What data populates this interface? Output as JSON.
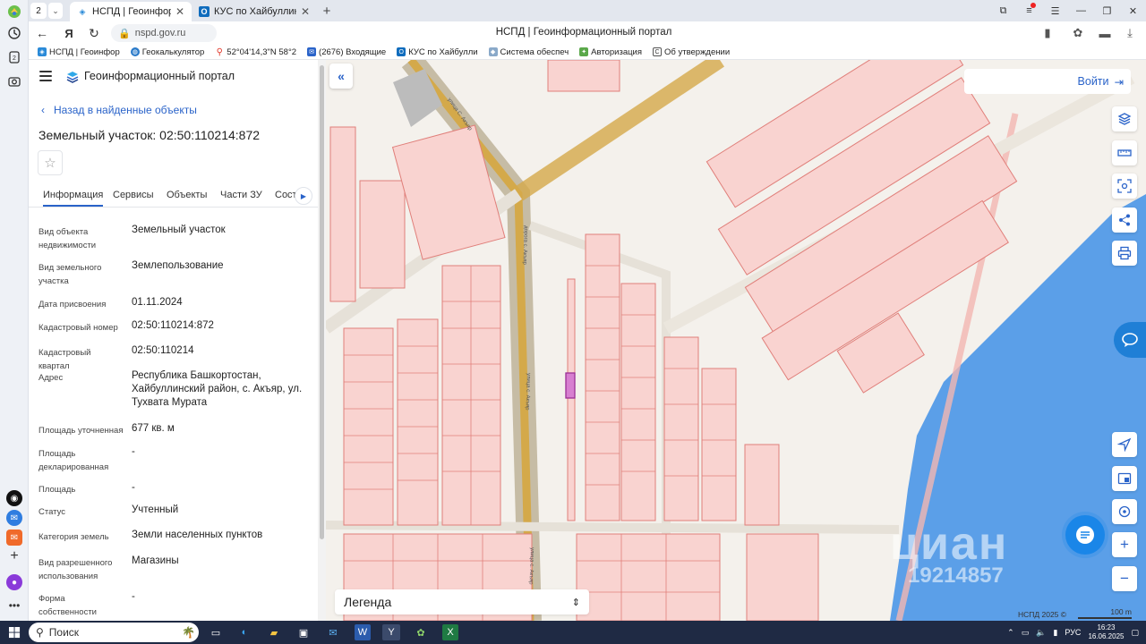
{
  "browser": {
    "tab_count": "2",
    "tabs": [
      {
        "title": "НСПД | Геоинформационный портал",
        "active": true
      },
      {
        "title": "КУС по Хайбуллинскому району",
        "active": false
      }
    ],
    "url": "nspd.gov.ru",
    "page_title": "НСПД | Геоинформационный портал",
    "bookmarks": [
      "НСПД | Геоинфор",
      "Геокалькулятор",
      "52°04'14,3\"N 58°2",
      "(2676) Входящие",
      "КУС по Хайбулли",
      "Система обеспеч",
      "Авторизация",
      "Об утверждении"
    ]
  },
  "sidebar": {
    "portal_name": "Геоинформационный портал",
    "back_link": "Назад в найденные объекты",
    "title": "Земельный участок: 02:50:110214:872",
    "tabs": [
      "Информация",
      "Сервисы",
      "Объекты",
      "Части ЗУ",
      "Соста"
    ],
    "rows": [
      {
        "label": "Вид объекта недвижимости",
        "value": "Земельный участок"
      },
      {
        "label": "Вид земельного участка",
        "value": "Землепользование"
      },
      {
        "label": "Дата присвоения",
        "value": "01.11.2024"
      },
      {
        "label": "Кадастровый номер",
        "value": "02:50:110214:872"
      },
      {
        "label": "Кадастровый квартал",
        "value": "02:50:110214"
      },
      {
        "label": "Адрес",
        "value": "Республика Башкортостан, Хайбуллинский район, с. Акъяр, ул. Тухвата Мурата"
      },
      {
        "label": "Площадь уточненная",
        "value": "677 кв. м"
      },
      {
        "label": "Площадь декларированная",
        "value": "-"
      },
      {
        "label": "Площадь",
        "value": "-"
      },
      {
        "label": "Статус",
        "value": "Учтенный"
      },
      {
        "label": "Категория земель",
        "value": "Земли населенных пунктов"
      },
      {
        "label": "Вид разрешенного использования",
        "value": "Магазины"
      },
      {
        "label": "Форма собственности",
        "value": "-"
      }
    ]
  },
  "map": {
    "login_label": "Войти",
    "legend_label": "Легенда",
    "copyright": "НСПД 2025 ©",
    "scale_label": "100 m",
    "watermark_logo": "циан",
    "watermark_id": "19214857",
    "road_labels": [
      "улица С. Акъяр",
      "дорога с. Акъяр",
      "улица с. Акъяр",
      "улица с. Акъяр"
    ]
  },
  "taskbar": {
    "search_placeholder": "Поиск",
    "language": "РУС",
    "time": "16:23",
    "date": "16.06.2025"
  },
  "colors": {
    "accent": "#2a63c9",
    "parcel_fill": "#f9d3d0",
    "parcel_stroke": "#e07f7a",
    "water": "#5b9fe8",
    "road": "#d4a94a",
    "selected_parcel": "#d77fd0"
  }
}
